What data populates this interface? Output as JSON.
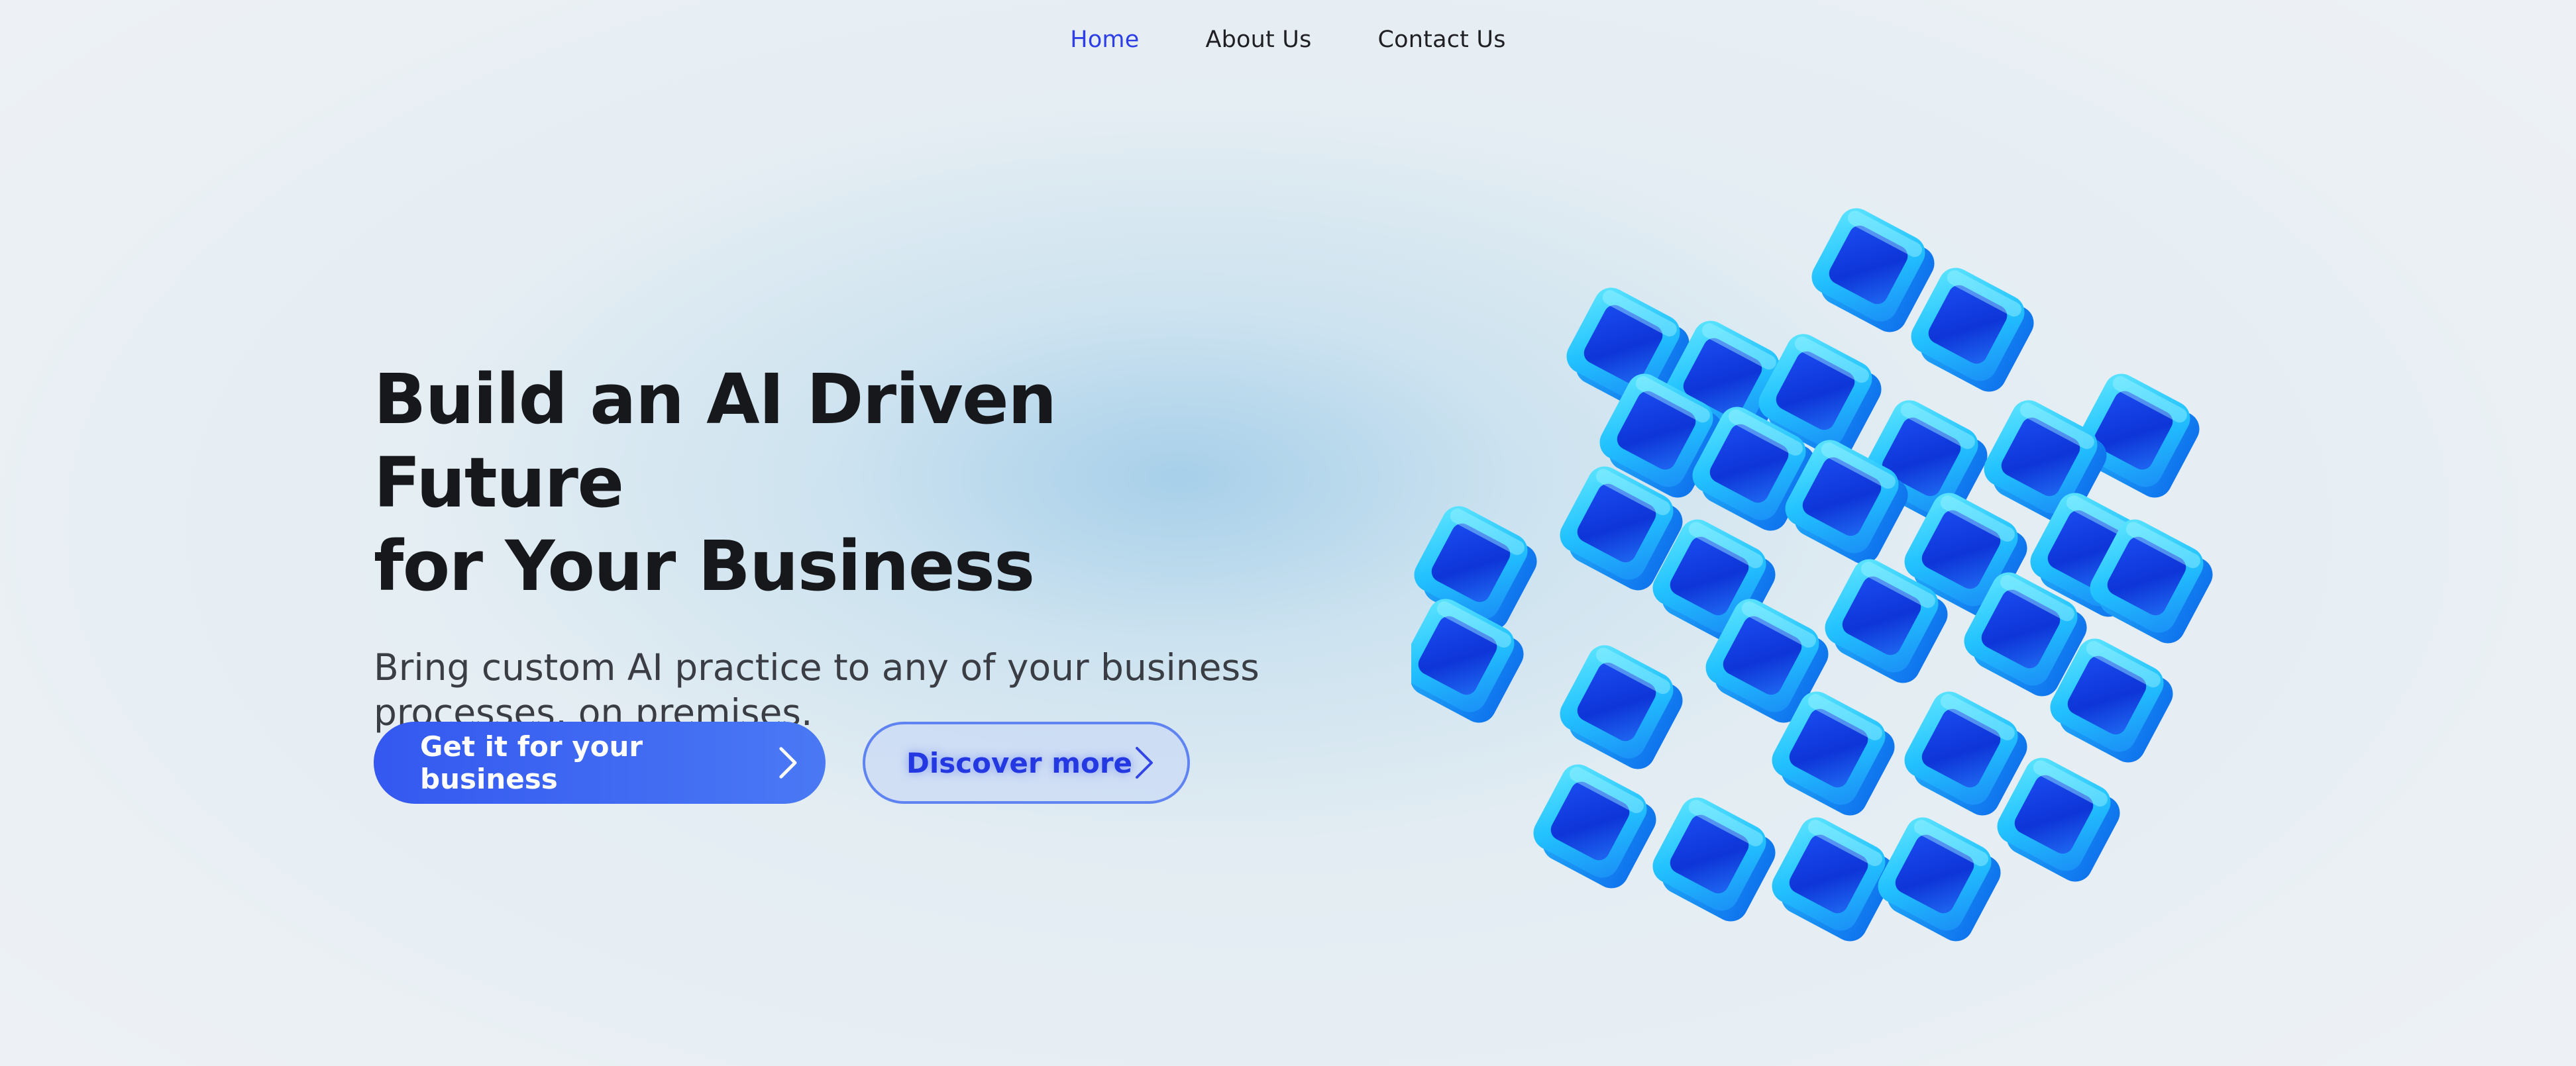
{
  "nav": {
    "items": [
      {
        "label": "Home",
        "active": true
      },
      {
        "label": "About Us",
        "active": false
      },
      {
        "label": "Contact Us",
        "active": false
      }
    ]
  },
  "hero": {
    "title_line1": "Build an AI Driven Future",
    "title_line2": "for Your Business",
    "subtitle_line1": "Bring custom AI practice to any of your business",
    "subtitle_line2": "processes, on premises."
  },
  "buttons": {
    "primary_label": "Get it for your business",
    "secondary_label": "Discover more"
  },
  "illustration": {
    "icon": "blue-cubes-3d-illustration"
  },
  "colors": {
    "accent": "#3458f0",
    "nav_active": "#2d3ee6",
    "heading": "#16181b",
    "cube_dark": "#1242e8",
    "cube_light": "#2fd6ff"
  }
}
